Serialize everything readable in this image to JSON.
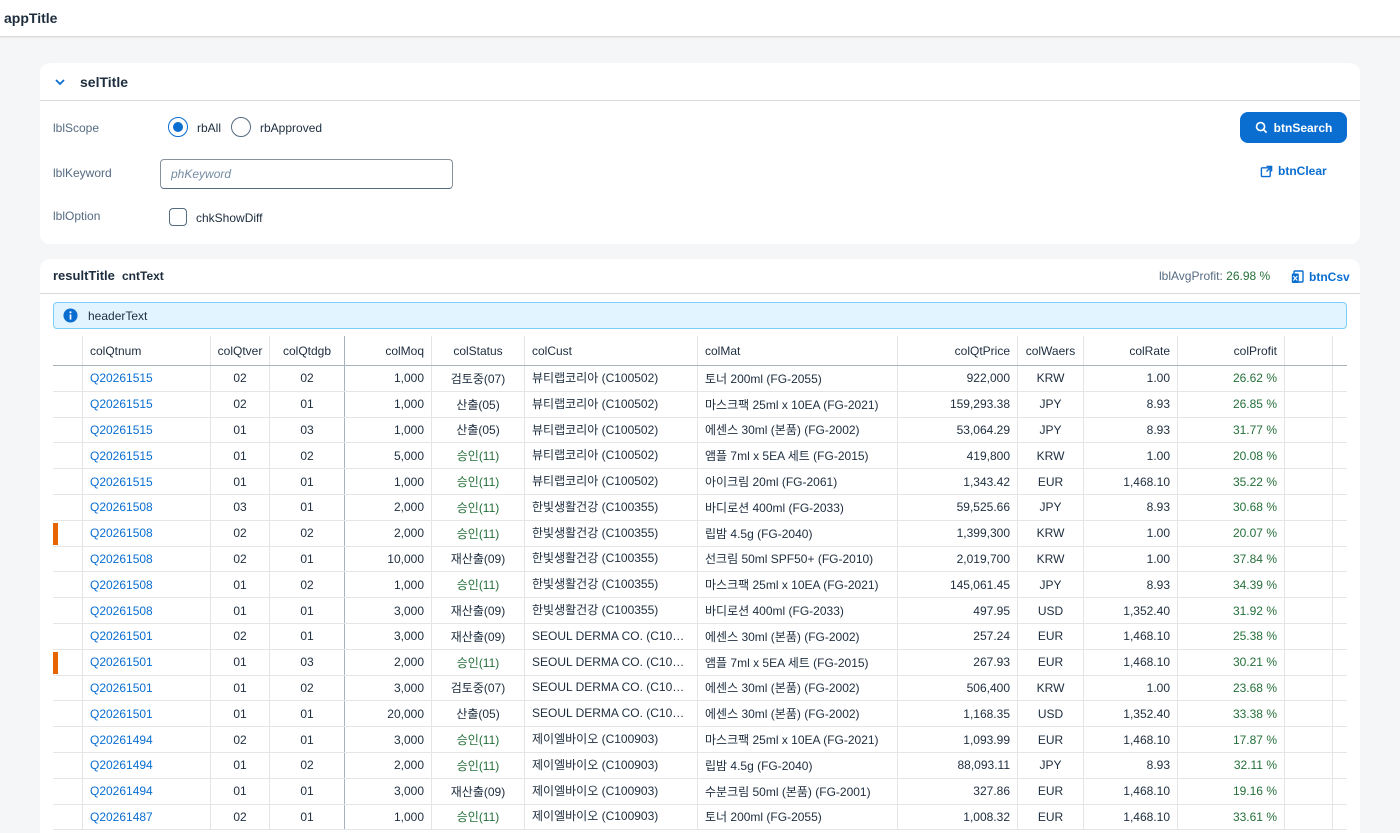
{
  "app": {
    "title": "appTitle"
  },
  "filter": {
    "title": "selTitle",
    "scope_label": "lblScope",
    "rb_all": "rbAll",
    "rb_approved": "rbApproved",
    "keyword_label": "lblKeyword",
    "keyword_placeholder": "phKeyword",
    "keyword_value": "",
    "option_label": "lblOption",
    "chk_show_diff": "chkShowDiff",
    "btn_search": "btnSearch",
    "btn_clear": "btnClear",
    "scope_selected": "rbAll"
  },
  "result": {
    "title": "resultTitle",
    "count_text": "cntText",
    "avg_profit_label": "lblAvgProfit:",
    "avg_profit_value": "26.98 %",
    "btn_csv": "btnCsv",
    "header_text": "headerText"
  },
  "columns": {
    "qtnum": "colQtnum",
    "qtver": "colQtver",
    "qtdgb": "colQtdgb",
    "moq": "colMoq",
    "status": "colStatus",
    "cust": "colCust",
    "mat": "colMat",
    "price": "colQtPrice",
    "waers": "colWaers",
    "rate": "colRate",
    "profit": "colProfit"
  },
  "colors": {
    "accent": "#0a6ed1",
    "positive": "#256f3a",
    "marker": "#e76500",
    "info_bg": "#e1f4ff"
  },
  "rows": [
    {
      "marker": false,
      "qtnum": "Q20261515",
      "qtver": "02",
      "qtdgb": "02",
      "moq": "1,000",
      "status": "검토중(07)",
      "approved": false,
      "cust": "뷰티랩코리아 (C100502)",
      "mat": "토너 200ml (FG-2055)",
      "price": "922,000",
      "waers": "KRW",
      "rate": "1.00",
      "profit": "26.62 %"
    },
    {
      "marker": false,
      "qtnum": "Q20261515",
      "qtver": "02",
      "qtdgb": "01",
      "moq": "1,000",
      "status": "산출(05)",
      "approved": false,
      "cust": "뷰티랩코리아 (C100502)",
      "mat": "마스크팩 25ml x 10EA (FG-2021)",
      "price": "159,293.38",
      "waers": "JPY",
      "rate": "8.93",
      "profit": "26.85 %"
    },
    {
      "marker": false,
      "qtnum": "Q20261515",
      "qtver": "01",
      "qtdgb": "03",
      "moq": "1,000",
      "status": "산출(05)",
      "approved": false,
      "cust": "뷰티랩코리아 (C100502)",
      "mat": "에센스 30ml (본품) (FG-2002)",
      "price": "53,064.29",
      "waers": "JPY",
      "rate": "8.93",
      "profit": "31.77 %"
    },
    {
      "marker": false,
      "qtnum": "Q20261515",
      "qtver": "01",
      "qtdgb": "02",
      "moq": "5,000",
      "status": "승인(11)",
      "approved": true,
      "cust": "뷰티랩코리아 (C100502)",
      "mat": "앰플 7ml x 5EA 세트 (FG-2015)",
      "price": "419,800",
      "waers": "KRW",
      "rate": "1.00",
      "profit": "20.08 %"
    },
    {
      "marker": false,
      "qtnum": "Q20261515",
      "qtver": "01",
      "qtdgb": "01",
      "moq": "1,000",
      "status": "승인(11)",
      "approved": true,
      "cust": "뷰티랩코리아 (C100502)",
      "mat": "아이크림 20ml (FG-2061)",
      "price": "1,343.42",
      "waers": "EUR",
      "rate": "1,468.10",
      "profit": "35.22 %"
    },
    {
      "marker": false,
      "qtnum": "Q20261508",
      "qtver": "03",
      "qtdgb": "01",
      "moq": "2,000",
      "status": "승인(11)",
      "approved": true,
      "cust": "한빛생활건강 (C100355)",
      "mat": "바디로션 400ml (FG-2033)",
      "price": "59,525.66",
      "waers": "JPY",
      "rate": "8.93",
      "profit": "30.68 %"
    },
    {
      "marker": true,
      "qtnum": "Q20261508",
      "qtver": "02",
      "qtdgb": "02",
      "moq": "2,000",
      "status": "승인(11)",
      "approved": true,
      "cust": "한빛생활건강 (C100355)",
      "mat": "립밤 4.5g (FG-2040)",
      "price": "1,399,300",
      "waers": "KRW",
      "rate": "1.00",
      "profit": "20.07 %"
    },
    {
      "marker": false,
      "qtnum": "Q20261508",
      "qtver": "02",
      "qtdgb": "01",
      "moq": "10,000",
      "status": "재산출(09)",
      "approved": false,
      "cust": "한빛생활건강 (C100355)",
      "mat": "선크림 50ml SPF50+ (FG-2010)",
      "price": "2,019,700",
      "waers": "KRW",
      "rate": "1.00",
      "profit": "37.84 %"
    },
    {
      "marker": false,
      "qtnum": "Q20261508",
      "qtver": "01",
      "qtdgb": "02",
      "moq": "1,000",
      "status": "승인(11)",
      "approved": true,
      "cust": "한빛생활건강 (C100355)",
      "mat": "마스크팩 25ml x 10EA (FG-2021)",
      "price": "145,061.45",
      "waers": "JPY",
      "rate": "8.93",
      "profit": "34.39 %"
    },
    {
      "marker": false,
      "qtnum": "Q20261508",
      "qtver": "01",
      "qtdgb": "01",
      "moq": "3,000",
      "status": "재산출(09)",
      "approved": false,
      "cust": "한빛생활건강 (C100355)",
      "mat": "바디로션 400ml (FG-2033)",
      "price": "497.95",
      "waers": "USD",
      "rate": "1,352.40",
      "profit": "31.92 %"
    },
    {
      "marker": false,
      "qtnum": "Q20261501",
      "qtver": "02",
      "qtdgb": "01",
      "moq": "3,000",
      "status": "재산출(09)",
      "approved": false,
      "cust": "SEOUL DERMA CO. (C1006...",
      "mat": "에센스 30ml (본품) (FG-2002)",
      "price": "257.24",
      "waers": "EUR",
      "rate": "1,468.10",
      "profit": "25.38 %"
    },
    {
      "marker": true,
      "qtnum": "Q20261501",
      "qtver": "01",
      "qtdgb": "03",
      "moq": "2,000",
      "status": "승인(11)",
      "approved": true,
      "cust": "SEOUL DERMA CO. (C1006...",
      "mat": "앰플 7ml x 5EA 세트 (FG-2015)",
      "price": "267.93",
      "waers": "EUR",
      "rate": "1,468.10",
      "profit": "30.21 %"
    },
    {
      "marker": false,
      "qtnum": "Q20261501",
      "qtver": "01",
      "qtdgb": "02",
      "moq": "3,000",
      "status": "검토중(07)",
      "approved": false,
      "cust": "SEOUL DERMA CO. (C1006...",
      "mat": "에센스 30ml (본품) (FG-2002)",
      "price": "506,400",
      "waers": "KRW",
      "rate": "1.00",
      "profit": "23.68 %"
    },
    {
      "marker": false,
      "qtnum": "Q20261501",
      "qtver": "01",
      "qtdgb": "01",
      "moq": "20,000",
      "status": "산출(05)",
      "approved": false,
      "cust": "SEOUL DERMA CO. (C1006...",
      "mat": "에센스 30ml (본품) (FG-2002)",
      "price": "1,168.35",
      "waers": "USD",
      "rate": "1,352.40",
      "profit": "33.38 %"
    },
    {
      "marker": false,
      "qtnum": "Q20261494",
      "qtver": "02",
      "qtdgb": "01",
      "moq": "3,000",
      "status": "승인(11)",
      "approved": true,
      "cust": "제이엘바이오 (C100903)",
      "mat": "마스크팩 25ml x 10EA (FG-2021)",
      "price": "1,093.99",
      "waers": "EUR",
      "rate": "1,468.10",
      "profit": "17.87 %"
    },
    {
      "marker": false,
      "qtnum": "Q20261494",
      "qtver": "01",
      "qtdgb": "02",
      "moq": "2,000",
      "status": "승인(11)",
      "approved": true,
      "cust": "제이엘바이오 (C100903)",
      "mat": "립밤 4.5g (FG-2040)",
      "price": "88,093.11",
      "waers": "JPY",
      "rate": "8.93",
      "profit": "32.11 %"
    },
    {
      "marker": false,
      "qtnum": "Q20261494",
      "qtver": "01",
      "qtdgb": "01",
      "moq": "3,000",
      "status": "재산출(09)",
      "approved": false,
      "cust": "제이엘바이오 (C100903)",
      "mat": "수분크림 50ml (본품) (FG-2001)",
      "price": "327.86",
      "waers": "EUR",
      "rate": "1,468.10",
      "profit": "19.16 %"
    },
    {
      "marker": false,
      "qtnum": "Q20261487",
      "qtver": "02",
      "qtdgb": "01",
      "moq": "1,000",
      "status": "승인(11)",
      "approved": true,
      "cust": "제이엘바이오 (C100903)",
      "mat": "토너 200ml (FG-2055)",
      "price": "1,008.32",
      "waers": "EUR",
      "rate": "1,468.10",
      "profit": "33.61 %"
    }
  ]
}
